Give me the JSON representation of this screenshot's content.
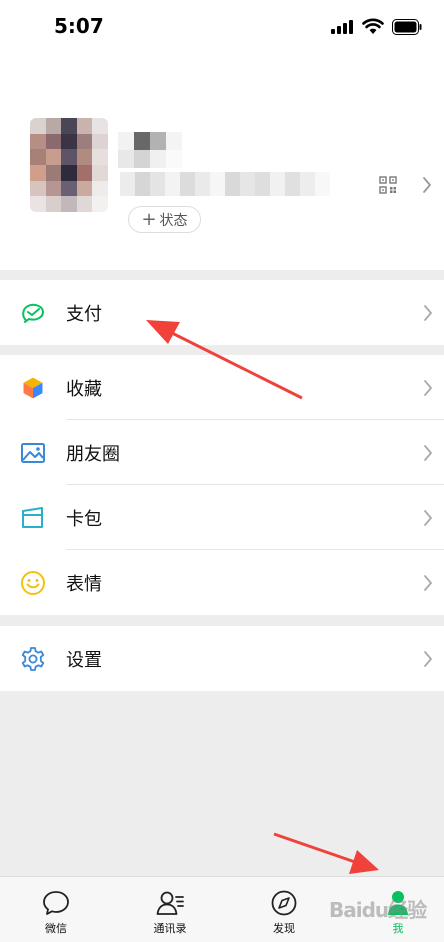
{
  "status_bar": {
    "time": "5:07"
  },
  "profile": {
    "status_button_label": "状态"
  },
  "menu": {
    "pay": "支付",
    "favorites": "收藏",
    "moments": "朋友圈",
    "cards": "卡包",
    "stickers": "表情",
    "settings": "设置"
  },
  "tabbar": {
    "tabs": [
      {
        "label": "微信",
        "icon": "chat-bubble-icon"
      },
      {
        "label": "通讯录",
        "icon": "contacts-icon"
      },
      {
        "label": "发现",
        "icon": "compass-icon"
      },
      {
        "label": "我",
        "icon": "person-icon",
        "active": true
      }
    ]
  },
  "watermark": "Baidu经验",
  "colors": {
    "accent": "#07c160",
    "annotation_arrow": "#f0413b",
    "background": "#ededed"
  }
}
